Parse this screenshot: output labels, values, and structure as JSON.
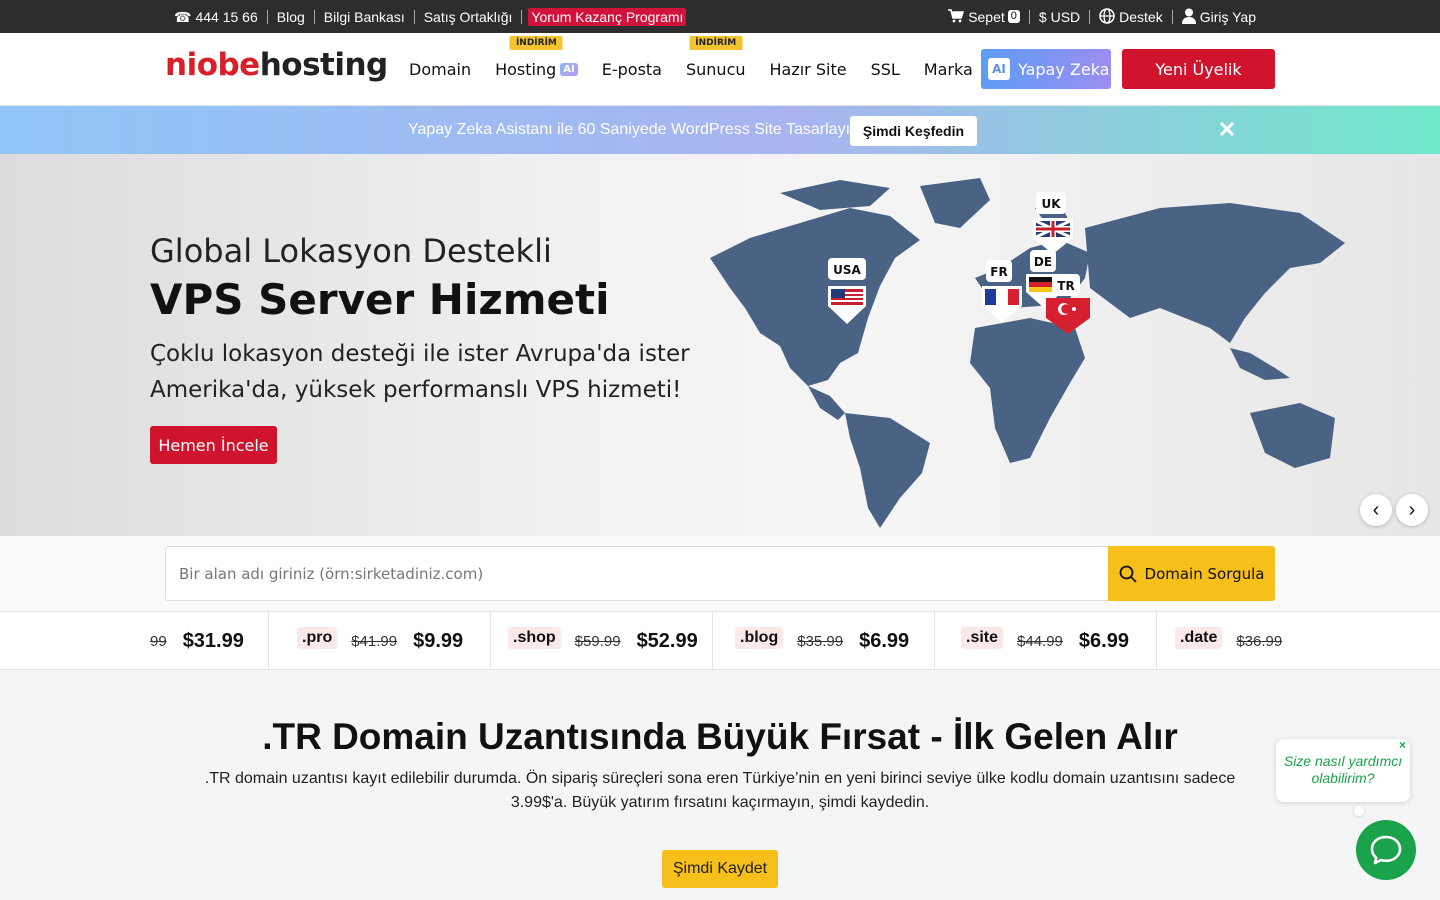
{
  "topbar": {
    "phone": "444 15 66",
    "links": [
      "Blog",
      "Bilgi Bankası",
      "Satış Ortaklığı"
    ],
    "highlight": "Yorum Kazanç Programı",
    "cart_label": "Sepet",
    "cart_count": "0",
    "currency": "$ USD",
    "support": "Destek",
    "login": "Giriş Yap"
  },
  "header": {
    "logo_part1": "niobe",
    "logo_part2": "hosting",
    "nav": [
      {
        "label": "Domain",
        "badge": ""
      },
      {
        "label": "Hosting",
        "badge": "İNDİRİM",
        "chip": "AI"
      },
      {
        "label": "E-posta",
        "badge": ""
      },
      {
        "label": "Sunucu",
        "badge": "İNDİRİM"
      },
      {
        "label": "Hazır Site",
        "badge": ""
      },
      {
        "label": "SSL",
        "badge": ""
      },
      {
        "label": "Marka",
        "badge": ""
      }
    ],
    "ai_button": "Yapay Zeka",
    "ai_icon_text": "AI",
    "register": "Yeni Üyelik"
  },
  "promo": {
    "text": "Yapay Zeka Asistanı ile 60 Saniyede WordPress Site Tasarlayın",
    "button": "Şimdi Keşfedin"
  },
  "hero": {
    "subtitle": "Global Lokasyon Destekli",
    "title": "VPS Server Hizmeti",
    "description": "Çoklu lokasyon desteği ile ister Avrupa'da ister Amerika'da, yüksek performanslı VPS hizmeti!",
    "button": "Hemen İncele",
    "locations": [
      "USA",
      "UK",
      "FR",
      "DE",
      "TR"
    ],
    "prev": "‹",
    "next": "›"
  },
  "search": {
    "placeholder": "Bir alan adı giriniz (örn:sirketadiniz.com)",
    "button": "Domain Sorgula"
  },
  "tlds": [
    {
      "ext": "",
      "old": "99",
      "new": "$31.99"
    },
    {
      "ext": ".pro",
      "old": "$41.99",
      "new": "$9.99"
    },
    {
      "ext": ".shop",
      "old": "$59.99",
      "new": "$52.99"
    },
    {
      "ext": ".blog",
      "old": "$35.99",
      "new": "$6.99"
    },
    {
      "ext": ".site",
      "old": "$44.99",
      "new": "$6.99"
    },
    {
      "ext": ".date",
      "old": "$36.99",
      "new": ""
    }
  ],
  "tr_section": {
    "title": ".TR Domain Uzantısında Büyük Fırsat - İlk Gelen Alır",
    "description": ".TR domain uzantısı kayıt edilebilir durumda. Ön sipariş süreçleri sona eren Türkiye’nin en yeni birinci seviye ülke kodlu domain uzantısını sadece 3.99$'a. Büyük yatırım fırsatını kaçırmayın, şimdi kaydedin.",
    "button": "Şimdi Kaydet"
  },
  "chat": {
    "bubble": "Size nasıl yardımcı olabilirim?",
    "close": "×"
  },
  "colors": {
    "brand_red": "#d1142d",
    "accent_yellow": "#f7bf1a",
    "chat_green": "#1aa34a",
    "map_blue": "#4a6385"
  }
}
